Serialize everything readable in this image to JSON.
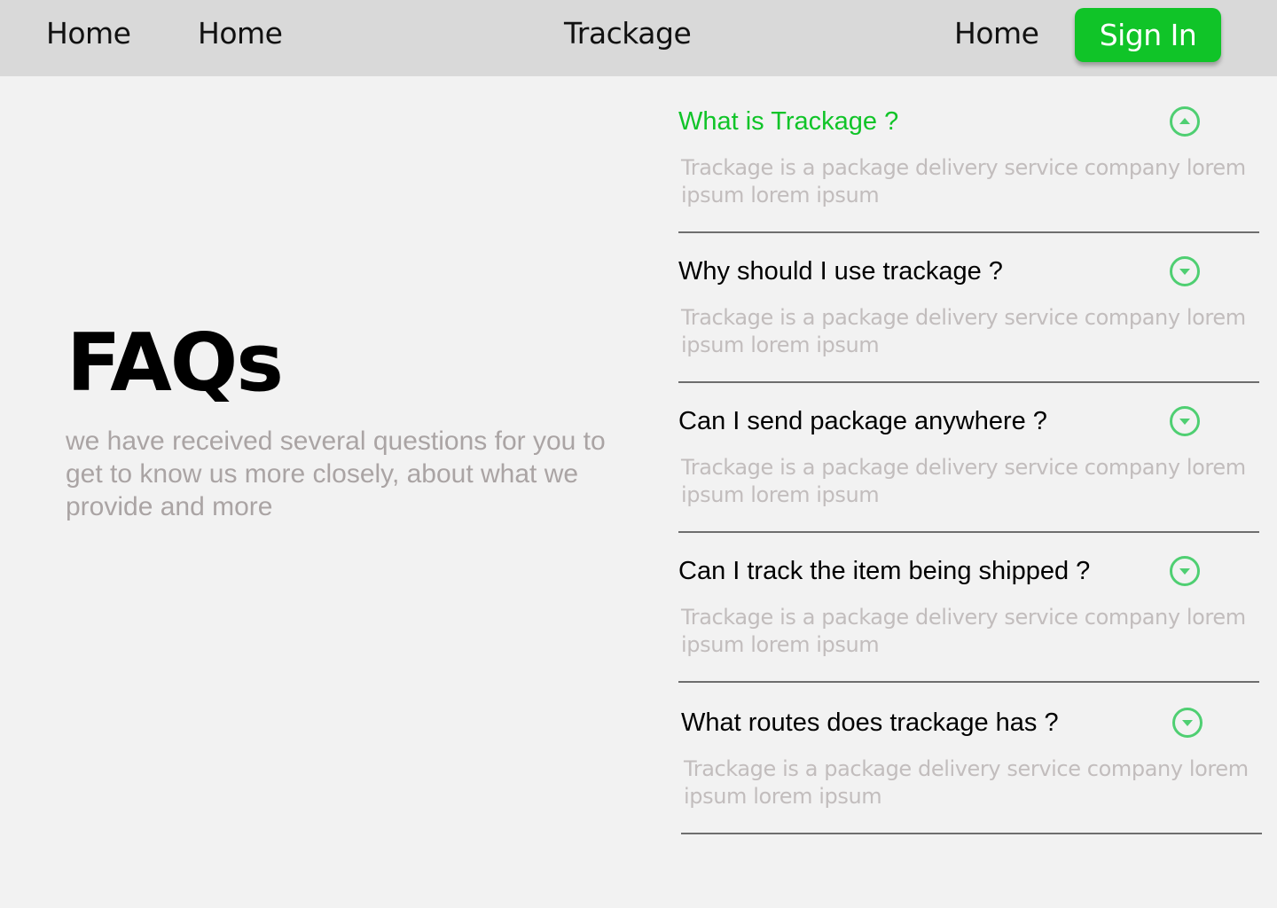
{
  "nav": {
    "links": [
      "Home",
      "Home",
      "Home"
    ],
    "brand": "Trackage",
    "signin_label": "Sign In"
  },
  "hero": {
    "title": "FAQs",
    "subtitle": "we have received several questions for you to get to know us more closely, about what we provide and more"
  },
  "faq": {
    "items": [
      {
        "question": "What is Trackage ?",
        "answer": "Trackage is a package delivery service company lorem ipsum lorem ipsum",
        "expanded": true
      },
      {
        "question": "Why should I use trackage ?",
        "answer": "Trackage is a package delivery service company lorem ipsum lorem ipsum",
        "expanded": false
      },
      {
        "question": "Can I send package anywhere ?",
        "answer": "Trackage is a package delivery service company lorem ipsum lorem ipsum",
        "expanded": false
      },
      {
        "question": "Can I track the item being shipped ?",
        "answer": "Trackage is a package delivery service company lorem ipsum lorem ipsum",
        "expanded": false
      },
      {
        "question": "What routes does trackage has ?",
        "answer": "Trackage is a package delivery service company lorem ipsum lorem ipsum",
        "expanded": false
      }
    ]
  },
  "colors": {
    "accent": "#10c428",
    "icon": "#4fcf72",
    "navbar_bg": "#d9d9d9",
    "page_bg": "#f2f2f2",
    "subtitle": "#aaa4a4",
    "answer": "#c2bdbd"
  },
  "icons": {
    "expanded": "chevron-up-circle-icon",
    "collapsed": "chevron-down-circle-icon"
  }
}
